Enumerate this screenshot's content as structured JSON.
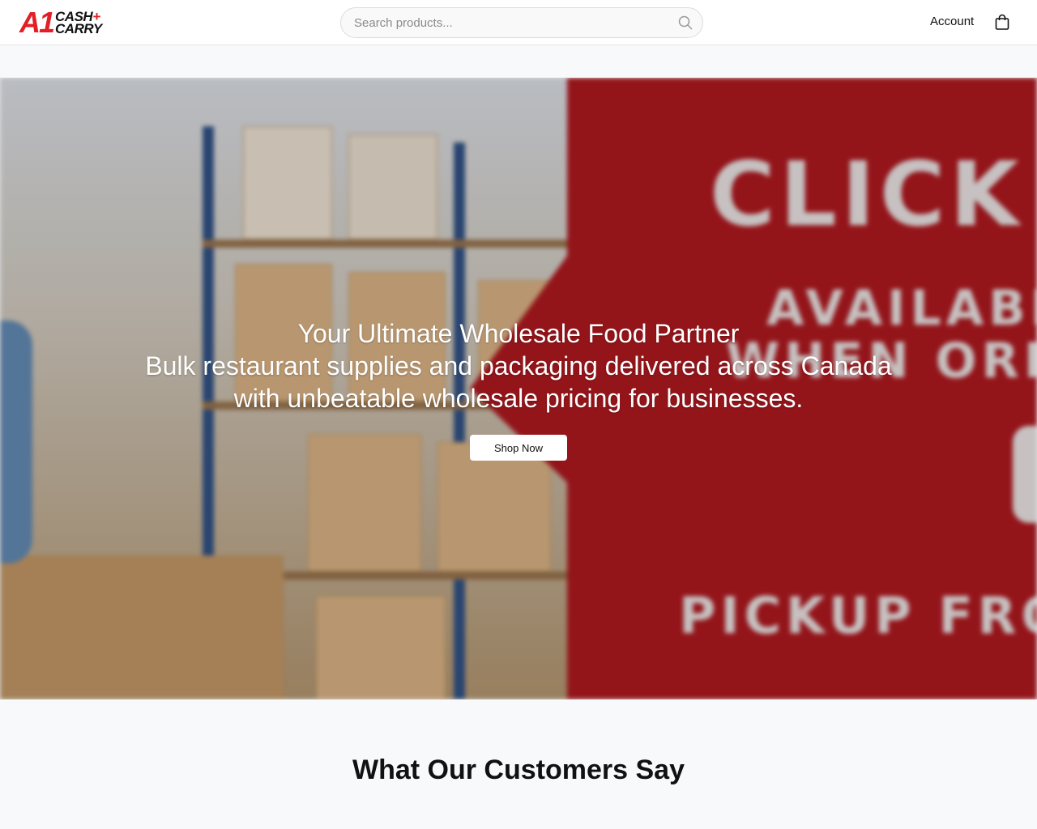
{
  "brand": {
    "logo_main": "A1",
    "logo_line1": "CASH",
    "logo_plus": "+",
    "logo_line2": "CARRY"
  },
  "header": {
    "search_placeholder": "Search products...",
    "account_label": "Account",
    "cart_icon": "shopping-bag-icon",
    "search_icon": "search-icon"
  },
  "hero": {
    "title": "Your Ultimate Wholesale Food Partner",
    "subtitle": "Bulk restaurant supplies and packaging delivered across Canada with unbeatable wholesale pricing for businesses.",
    "cta_label": "Shop Now",
    "banner_text_1": "CLICK",
    "banner_text_2": "AVAILABLE A",
    "banner_text_3": "WHEN ORDER",
    "banner_text_4": "PICKUP FROM M",
    "accent_color": "#a0171d"
  },
  "testimonials": {
    "heading": "What Our Customers Say"
  },
  "colors": {
    "brand_red": "#e21f26",
    "page_bg": "#f8f9fa"
  }
}
